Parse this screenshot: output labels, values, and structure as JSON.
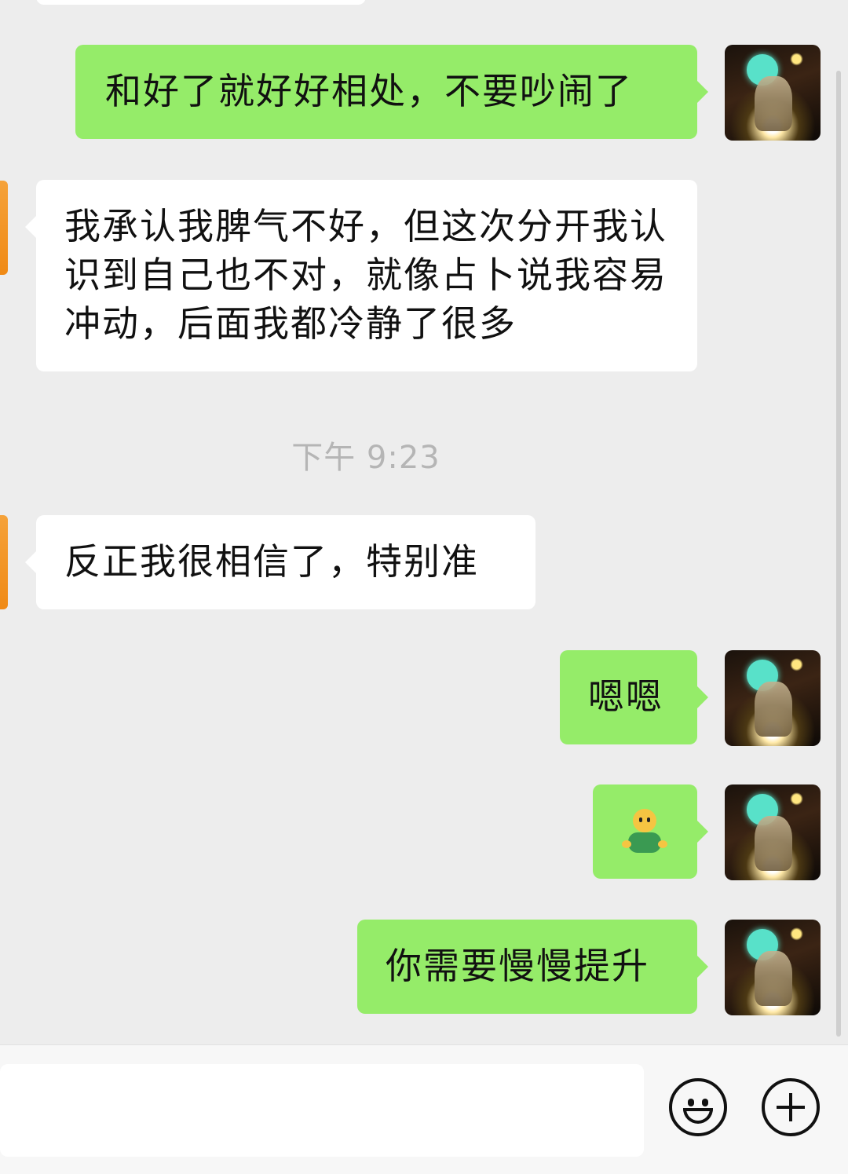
{
  "messages": [
    {
      "side": "me",
      "text": "和好了就好好相处，不要吵闹了"
    },
    {
      "side": "them",
      "text": "我承认我脾气不好，但这次分开我认识到自己也不对，就像占卜说我容易冲动，后面我都冷静了很多"
    },
    {
      "side": "them",
      "text": "反正我很相信了，特别准"
    },
    {
      "side": "me",
      "text": "嗯嗯"
    },
    {
      "side": "me",
      "type": "sticker",
      "sticker": "shrug-emoji"
    },
    {
      "side": "me",
      "text": "你需要慢慢提升"
    }
  ],
  "timestamp": "下午 9:23",
  "input": {
    "value": "",
    "placeholder": ""
  },
  "toolbar": {
    "emoji_icon": "smiley-icon",
    "plus_icon": "plus-circle-icon"
  }
}
